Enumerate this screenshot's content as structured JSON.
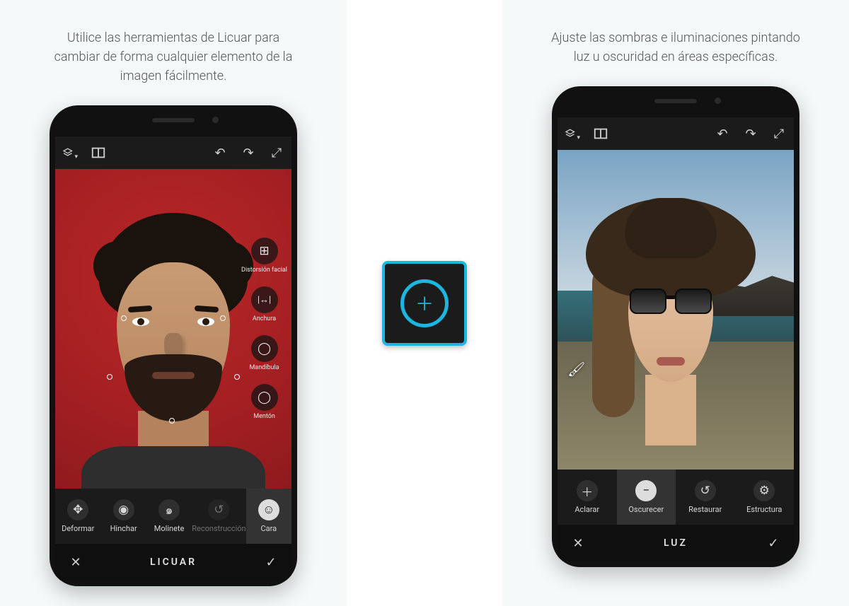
{
  "captions": {
    "left": "Utilice las herramientas de Licuar para cambiar de forma cualquier elemento de la imagen fácilmente.",
    "right": "Ajuste las sombras e iluminaciones pintando luz u oscuridad en áreas específicas."
  },
  "topbar_icons": {
    "layers": "layers-icon",
    "crop": "crop-before-after-icon",
    "undo": "↶",
    "redo": "↷",
    "fullscreen": "⤢"
  },
  "side_tools": [
    {
      "icon": "⊞",
      "label": "Distorsión facial"
    },
    {
      "icon": "|↔|",
      "label": "Anchura"
    },
    {
      "icon": "◯",
      "label": "Mandíbula"
    },
    {
      "icon": "◯",
      "label": "Mentón"
    }
  ],
  "bottom_tools_left": [
    {
      "icon": "✥",
      "label": "Deformar",
      "state": ""
    },
    {
      "icon": "◉",
      "label": "Hinchar",
      "state": ""
    },
    {
      "icon": "๑",
      "label": "Molinete",
      "state": ""
    },
    {
      "icon": "↺",
      "label": "Reconstrucción",
      "state": "disabled"
    },
    {
      "icon": "☺",
      "label": "Cara",
      "state": "selected"
    }
  ],
  "bottom_tools_right": [
    {
      "icon": "＋",
      "label": "Aclarar",
      "state": ""
    },
    {
      "icon": "−",
      "label": "Oscurecer",
      "state": "selected"
    },
    {
      "icon": "↺",
      "label": "Restaurar",
      "state": ""
    },
    {
      "icon": "⚙",
      "label": "Estructura",
      "state": ""
    }
  ],
  "mode_title_left": "LICUAR",
  "mode_title_right": "LUZ",
  "close_glyph": "✕",
  "confirm_glyph": "✓"
}
